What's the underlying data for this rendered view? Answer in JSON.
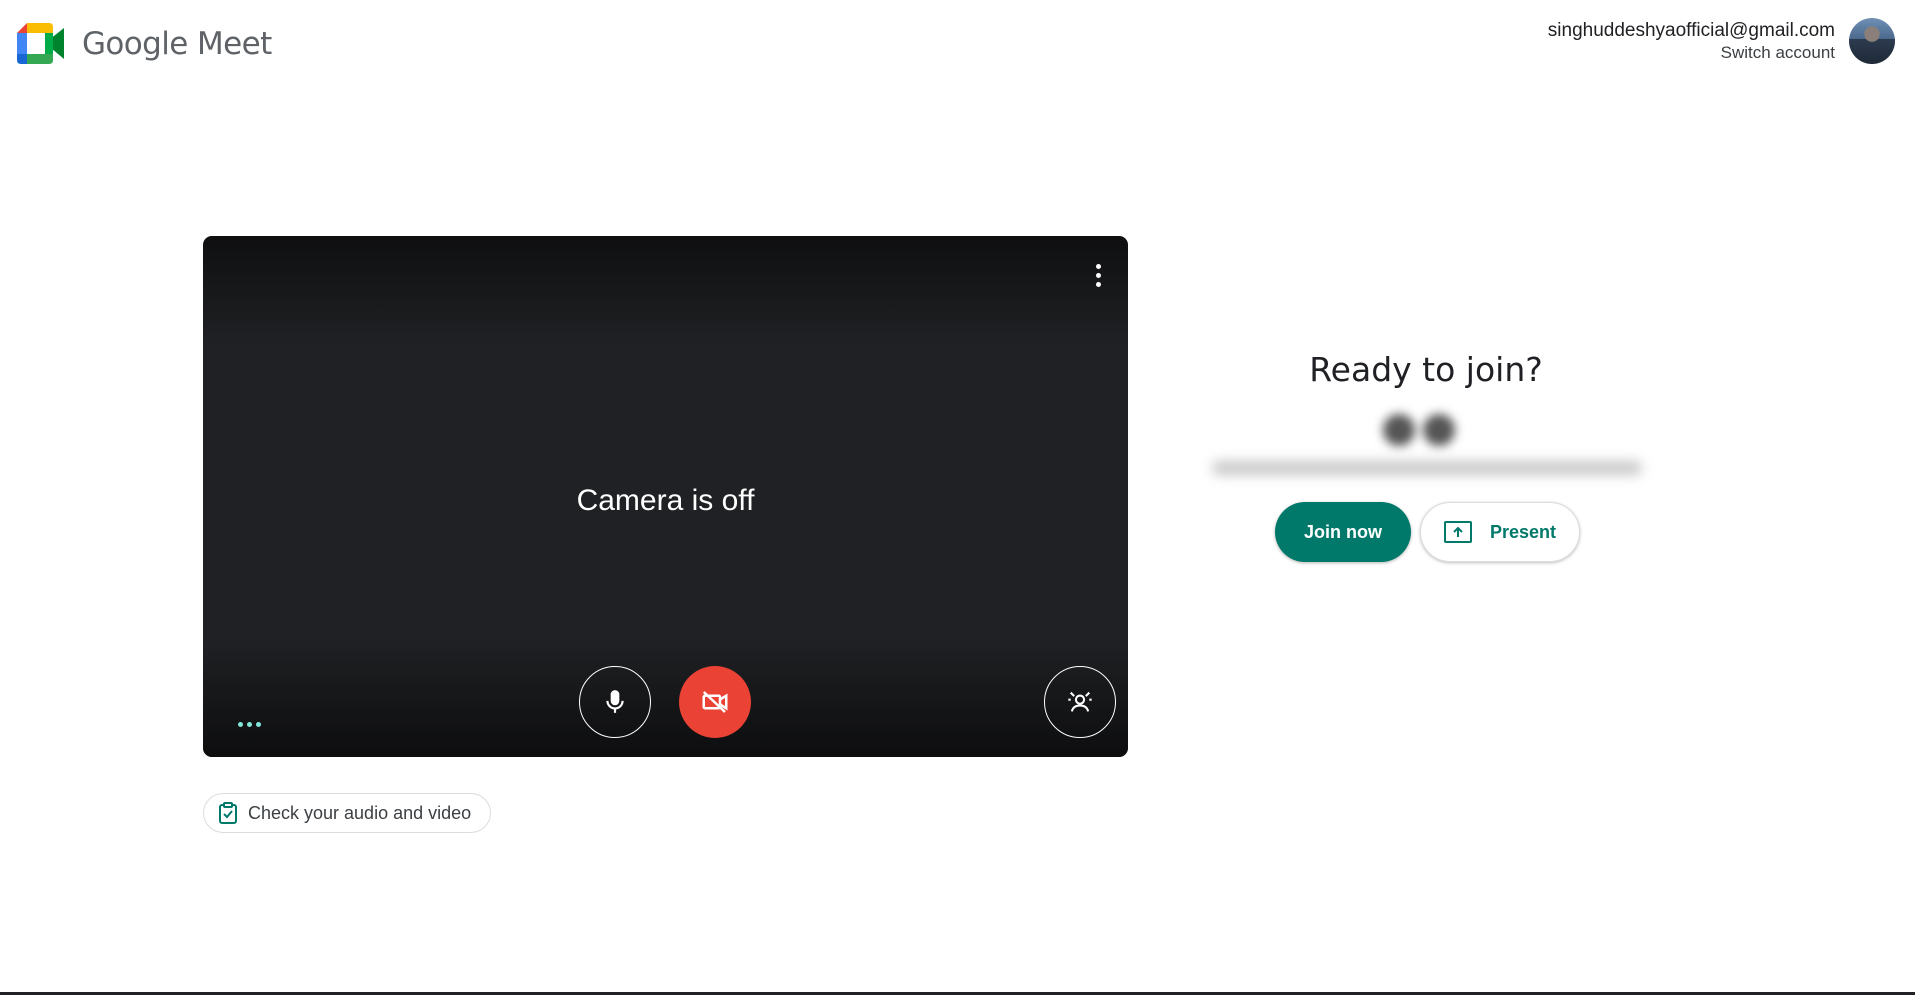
{
  "header": {
    "app_name": "Google Meet",
    "logo_icon": "google-meet-logo",
    "account": {
      "email": "singhuddeshyaofficial@gmail.com",
      "switch_label": "Switch account",
      "avatar_icon": "user-avatar"
    }
  },
  "preview": {
    "camera_status": "Camera is off",
    "more_options_icon": "more-vert-icon",
    "controls": {
      "mic_icon": "microphone-icon",
      "camera_icon": "video-off-icon",
      "effects_icon": "visual-effects-icon",
      "camera_button_color": "#ea4335"
    },
    "audio_indicator_color": "#81e6d9"
  },
  "check_audio": {
    "label": "Check your audio and video",
    "icon": "clipboard-check-icon"
  },
  "join_panel": {
    "title": "Ready to join?",
    "join_label": "Join now",
    "present_label": "Present",
    "present_icon": "present-screen-icon",
    "accent_color": "#00796b"
  }
}
